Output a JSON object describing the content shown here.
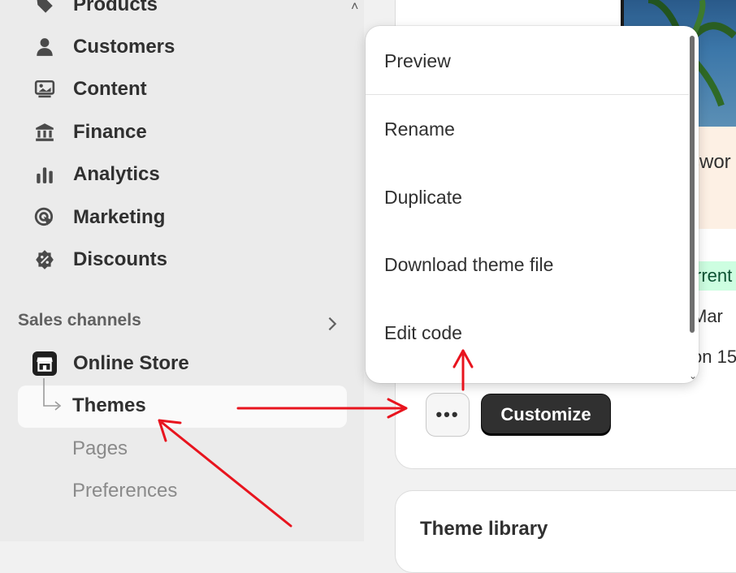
{
  "sidebar": {
    "items": [
      {
        "label": "Products",
        "icon": "tag-icon"
      },
      {
        "label": "Customers",
        "icon": "person-icon"
      },
      {
        "label": "Content",
        "icon": "image-icon"
      },
      {
        "label": "Finance",
        "icon": "bank-icon"
      },
      {
        "label": "Analytics",
        "icon": "bar-chart-icon"
      },
      {
        "label": "Marketing",
        "icon": "target-icon"
      },
      {
        "label": "Discounts",
        "icon": "percent-badge-icon"
      }
    ],
    "sales_channels_label": "Sales channels",
    "online_store": "Online Store",
    "sub_items": [
      "Themes",
      "Pages",
      "Preferences"
    ]
  },
  "menu": {
    "items": [
      "Preview",
      "Rename",
      "Duplicate",
      "Download theme file",
      "Edit code"
    ]
  },
  "theme_card": {
    "partial_text_1": "swor",
    "badge_text": "rrent",
    "partial_text_2": "Mar",
    "partial_text_3": "on 15",
    "more_button": "•••",
    "customize_button": "Customize"
  },
  "library": {
    "title": "Theme library"
  },
  "colors": {
    "annotation_arrow": "#e8141e",
    "primary_button": "#303030",
    "sidebar_bg": "#ebebeb"
  }
}
